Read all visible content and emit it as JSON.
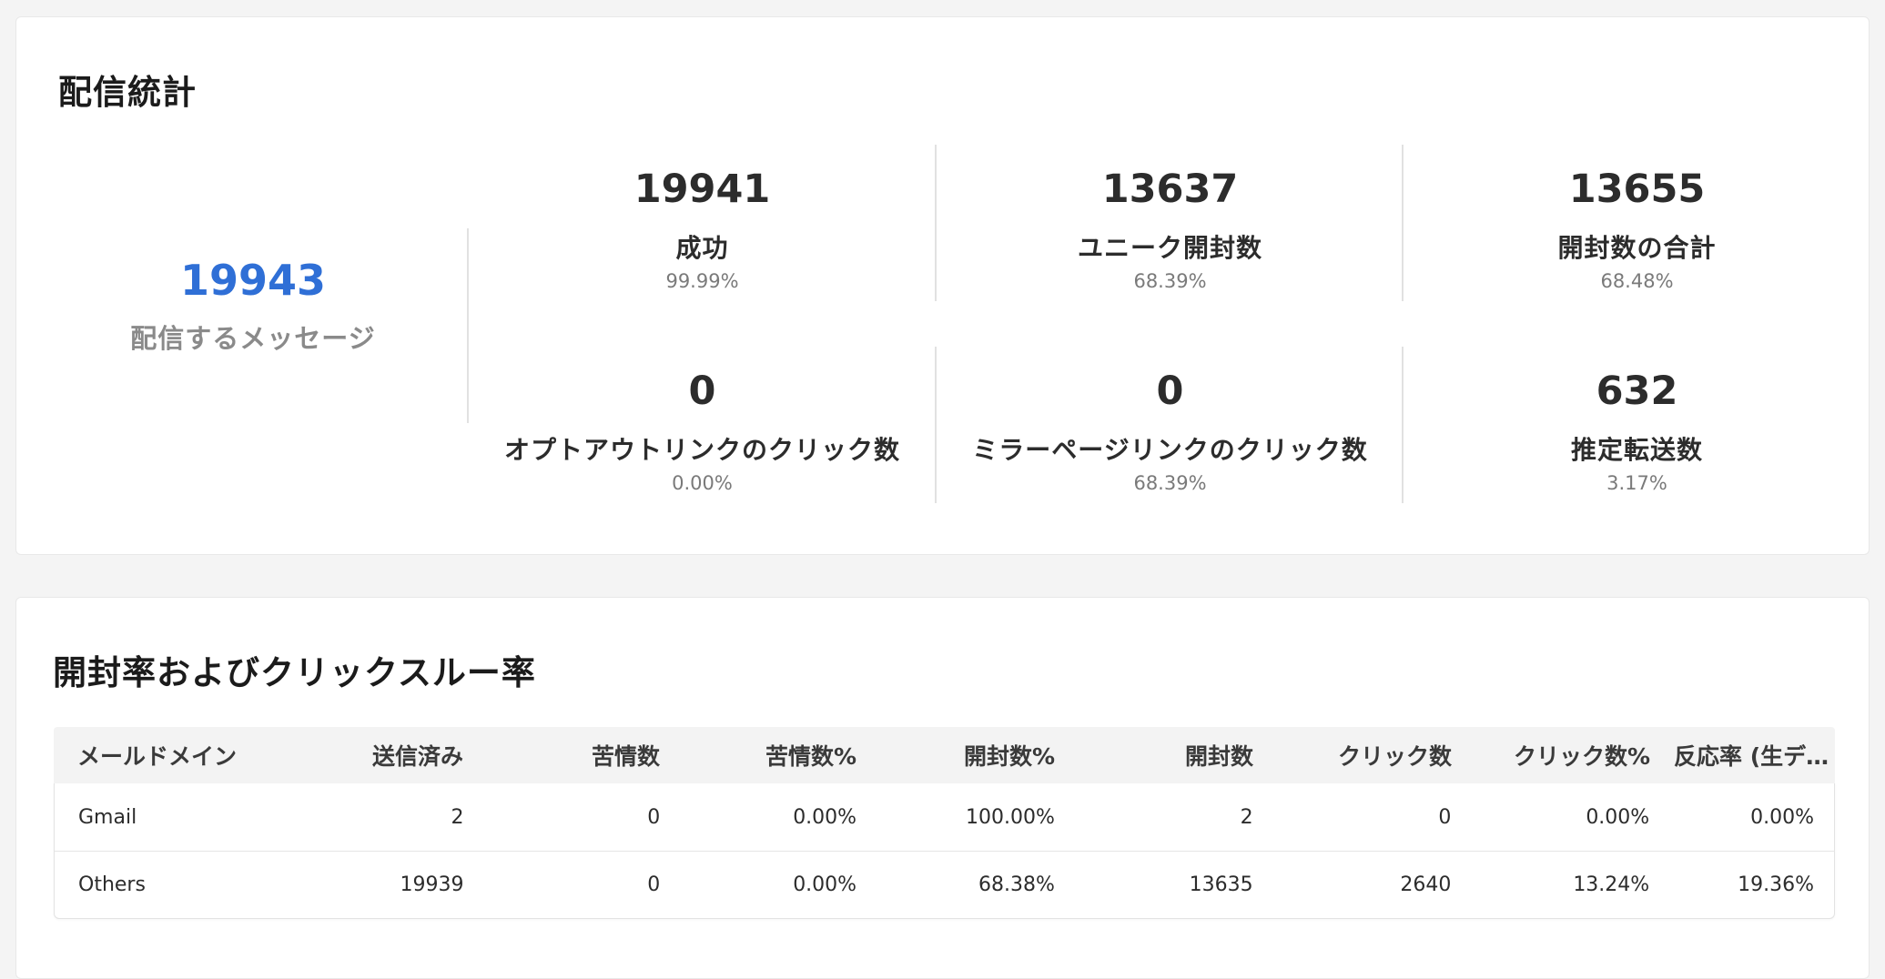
{
  "stats": {
    "title": "配信統計",
    "primary": {
      "value": "19943",
      "label": "配信するメッセージ"
    },
    "metrics": [
      {
        "value": "19941",
        "label": "成功",
        "percent": "99.99%"
      },
      {
        "value": "13637",
        "label": "ユニーク開封数",
        "percent": "68.39%"
      },
      {
        "value": "13655",
        "label": "開封数の合計",
        "percent": "68.48%"
      },
      {
        "value": "0",
        "label": "オプトアウトリンクのクリック数",
        "percent": "0.00%"
      },
      {
        "value": "0",
        "label": "ミラーページリンクのクリック数",
        "percent": "68.39%"
      },
      {
        "value": "632",
        "label": "推定転送数",
        "percent": "3.17%"
      }
    ]
  },
  "rates": {
    "title": "開封率およびクリックスルー率",
    "columns": [
      "メールドメイン",
      "送信済み",
      "苦情数",
      "苦情数%",
      "開封数%",
      "開封数",
      "クリック数",
      "クリック数%",
      "反応率 (生デ…"
    ],
    "rows": [
      [
        "Gmail",
        "2",
        "0",
        "0.00%",
        "100.00%",
        "2",
        "0",
        "0.00%",
        "0.00%"
      ],
      [
        "Others",
        "19939",
        "0",
        "0.00%",
        "68.38%",
        "13635",
        "2640",
        "13.24%",
        "19.36%"
      ]
    ]
  },
  "colors": {
    "accent": "#2f6fd6",
    "background": "#f4f4f4",
    "card": "#ffffff"
  }
}
